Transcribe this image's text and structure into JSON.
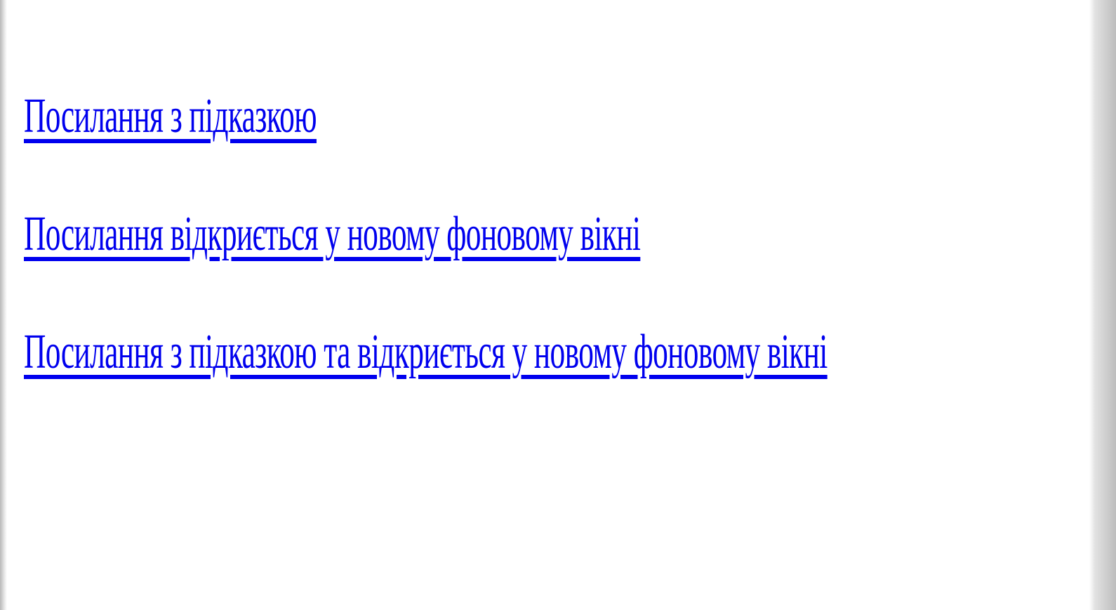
{
  "links": [
    {
      "label": "Посилання з підказкою"
    },
    {
      "label": "Посилання відкриється у новому фоновому вікні"
    },
    {
      "label": "Посилання з підказкою та відкриється у новому фоновому вікні"
    }
  ],
  "colors": {
    "link": "#0000ee",
    "background": "#ffffff"
  }
}
